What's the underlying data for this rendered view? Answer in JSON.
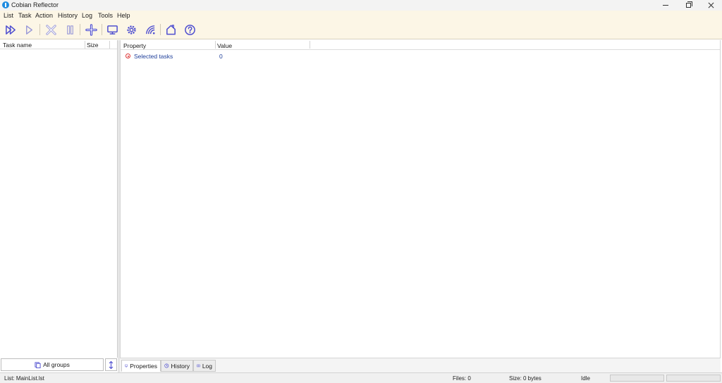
{
  "window": {
    "title": "Cobian Reflector"
  },
  "menu": [
    "List",
    "Task",
    "Action",
    "History",
    "Log",
    "Tools",
    "Help"
  ],
  "toolbar": {
    "icons": [
      "run-all-icon",
      "run-selected-icon",
      "stop-icon",
      "pause-icon",
      "add-task-icon",
      "computer-icon",
      "settings-icon",
      "wireless-icon",
      "home-icon",
      "help-icon"
    ],
    "accent_color": "#4f4fd0"
  },
  "task_list": {
    "columns": [
      "Task name",
      "Size"
    ]
  },
  "properties": {
    "columns": [
      "Property",
      "Value"
    ],
    "rows": [
      {
        "name": "Selected tasks",
        "value": "0"
      }
    ]
  },
  "groups": {
    "label": "All groups"
  },
  "tabs": [
    "Properties",
    "History",
    "Log"
  ],
  "status": {
    "list": "List: MainList.lst",
    "files": "Files: 0",
    "size": "Size: 0 bytes",
    "state": "Idle"
  }
}
